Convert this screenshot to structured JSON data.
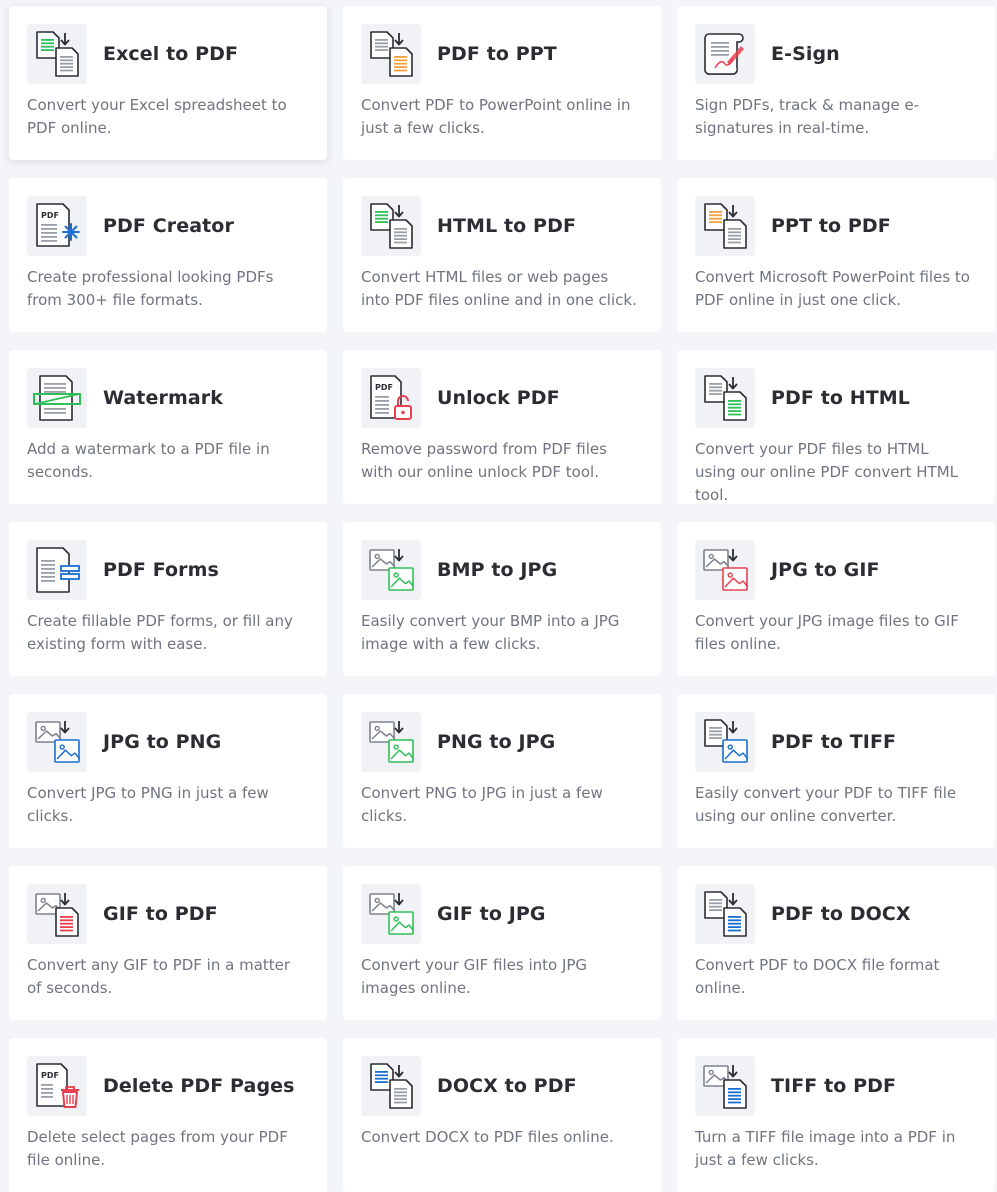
{
  "colors": {
    "green": "#2fbf5a",
    "orange": "#f2a03d",
    "blue": "#1a6fd1",
    "red": "#e8404e",
    "outline": "#2b2d33",
    "page_bg": "#f4f5f8"
  },
  "tools": [
    {
      "title": "Excel to PDF",
      "desc": "Convert your Excel spreadsheet to PDF online.",
      "icon": "excel-to-pdf-icon"
    },
    {
      "title": "PDF to PPT",
      "desc": "Convert PDF to PowerPoint online in just a few clicks.",
      "icon": "pdf-to-ppt-icon"
    },
    {
      "title": "E-Sign",
      "desc": "Sign PDFs, track & manage e-signatures in real-time.",
      "icon": "esign-scroll-icon"
    },
    {
      "title": "PDF Creator",
      "desc": "Create professional looking PDFs from 300+ file formats.",
      "icon": "pdf-creator-icon"
    },
    {
      "title": "HTML to PDF",
      "desc": "Convert HTML files or web pages into PDF files online and in one click.",
      "icon": "html-to-pdf-icon"
    },
    {
      "title": "PPT to PDF",
      "desc": "Convert Microsoft PowerPoint files to PDF online in just one click.",
      "icon": "ppt-to-pdf-icon"
    },
    {
      "title": "Watermark",
      "desc": "Add a watermark to a PDF file in seconds.",
      "icon": "watermark-icon"
    },
    {
      "title": "Unlock PDF",
      "desc": "Remove password from PDF files with our online unlock PDF tool.",
      "icon": "unlock-pdf-icon"
    },
    {
      "title": "PDF to HTML",
      "desc": "Convert your PDF files to HTML using our online PDF convert HTML tool.",
      "icon": "pdf-to-html-icon"
    },
    {
      "title": "PDF Forms",
      "desc": "Create fillable PDF forms, or fill any existing form with ease.",
      "icon": "pdf-forms-icon"
    },
    {
      "title": "BMP to JPG",
      "desc": "Easily convert your BMP into a JPG image with a few clicks.",
      "icon": "bmp-to-jpg-icon"
    },
    {
      "title": "JPG to GIF",
      "desc": "Convert your JPG image files to GIF files online.",
      "icon": "jpg-to-gif-icon"
    },
    {
      "title": "JPG to PNG",
      "desc": "Convert JPG to PNG in just a few clicks.",
      "icon": "jpg-to-png-icon"
    },
    {
      "title": "PNG to JPG",
      "desc": "Convert PNG to JPG in just a few clicks.",
      "icon": "png-to-jpg-icon"
    },
    {
      "title": "PDF to TIFF",
      "desc": "Easily convert your PDF to TIFF file using our online converter.",
      "icon": "pdf-to-tiff-icon"
    },
    {
      "title": "GIF to PDF",
      "desc": "Convert any GIF to PDF in a matter of seconds.",
      "icon": "gif-to-pdf-icon"
    },
    {
      "title": "GIF to JPG",
      "desc": "Convert your GIF files into JPG images online.",
      "icon": "gif-to-jpg-icon"
    },
    {
      "title": "PDF to DOCX",
      "desc": "Convert PDF to DOCX file format online.",
      "icon": "pdf-to-docx-icon"
    },
    {
      "title": "Delete PDF Pages",
      "desc": "Delete select pages from your PDF file online.",
      "icon": "delete-pdf-pages-icon"
    },
    {
      "title": "DOCX to PDF",
      "desc": "Convert DOCX to PDF files online.",
      "icon": "docx-to-pdf-icon"
    },
    {
      "title": "TIFF to PDF",
      "desc": "Turn a TIFF file image into a PDF in just a few clicks.",
      "icon": "tiff-to-pdf-icon"
    }
  ],
  "icon_labels": {
    "pdf": "PDF"
  }
}
